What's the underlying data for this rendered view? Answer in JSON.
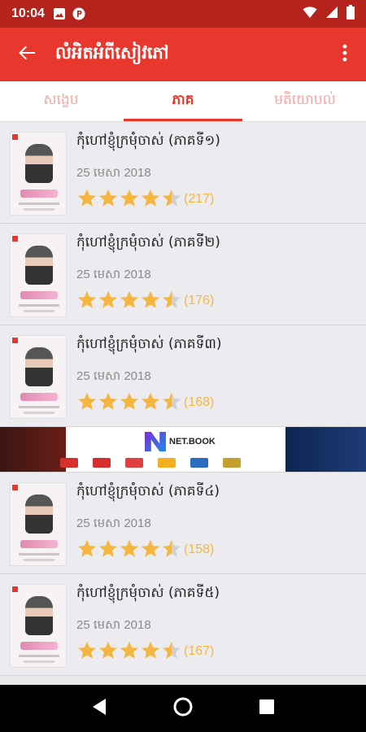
{
  "status_bar": {
    "time": "10:04"
  },
  "app_bar": {
    "title": "លំអិតអំពីសៀវភៅ"
  },
  "tabs": [
    {
      "label": "សង្ខេប",
      "active": false
    },
    {
      "label": "ភាគ",
      "active": true
    },
    {
      "label": "មតិយោបល់",
      "active": false
    }
  ],
  "episodes": [
    {
      "title": "កុំហៅខ្ញុំក្រមុំចាស់ (ភាគទី១)",
      "date": "25 មេសា 2018",
      "rating": 4.5,
      "count": "(217)"
    },
    {
      "title": "កុំហៅខ្ញុំក្រមុំចាស់ (ភាគទី២)",
      "date": "25 មេសា 2018",
      "rating": 4.5,
      "count": "(176)"
    },
    {
      "title": "កុំហៅខ្ញុំក្រមុំចាស់ (ភាគទី៣)",
      "date": "25 មេសា 2018",
      "rating": 4.5,
      "count": "(168)"
    },
    {
      "title": "កុំហៅខ្ញុំក្រមុំចាស់ (ភាគទី៤)",
      "date": "25 មេសា 2018",
      "rating": 4.5,
      "count": "(158)"
    },
    {
      "title": "កុំហៅខ្ញុំក្រមុំចាស់ (ភាគទី៥)",
      "date": "25 មេសា 2018",
      "rating": 4.5,
      "count": "(167)"
    }
  ],
  "ad": {
    "brand": "NET.BOOK"
  },
  "colors": {
    "primary": "#e8382e",
    "status_bar": "#b5241c",
    "star": "#f4b63f"
  }
}
